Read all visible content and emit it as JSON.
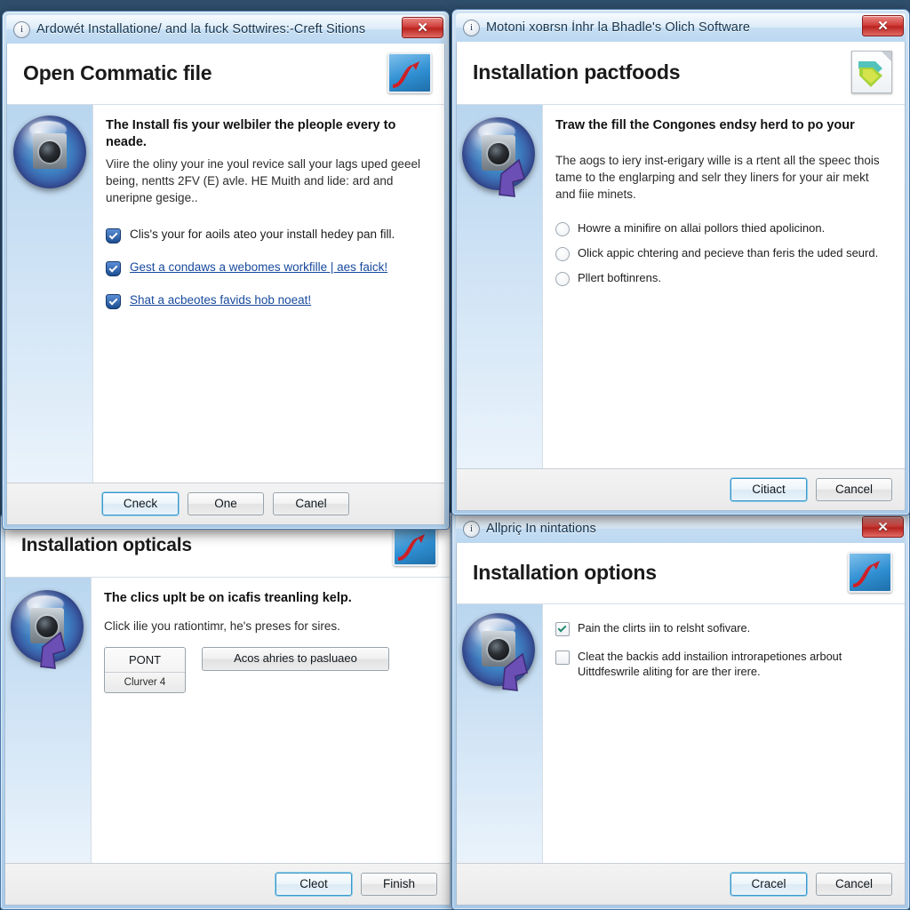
{
  "windows": {
    "w1": {
      "titlebar": {
        "icon": "info-circle-icon",
        "title": "Ardowét Installatione/ and la fuck Sottwires:-Creft Sitions",
        "close_label": "✕"
      },
      "header": {
        "heading": "Open Commatic file",
        "icon": "chart-swoosh-icon"
      },
      "body": {
        "sidebar_icon": "camera-orb-icon",
        "lead": "The Install fis your welbiler the pleople every to neade.",
        "paragraph": "Viire the oliny your ine youl revice sall your lags uped geeel being, nentts 2FV (E) avle. HE Muith and lide: ard and uneripne gesige..",
        "tasks": [
          {
            "type": "text",
            "icon": "shield-check-icon",
            "label": "Clis's your for aoils ateo your install hedey pan fill."
          },
          {
            "type": "link",
            "icon": "shield-check-icon",
            "label": "Gest a condaws a webomes workfille | aes faick!"
          },
          {
            "type": "link",
            "icon": "shield-check-icon",
            "label": "Shat a acbeotes favids hob noeat!"
          }
        ]
      },
      "footer": {
        "buttons": [
          {
            "label": "Cneck",
            "default": true
          },
          {
            "label": "One",
            "default": false
          },
          {
            "label": "Canel",
            "default": false
          }
        ]
      }
    },
    "w2": {
      "titlebar": {
        "icon": "info-circle-icon",
        "title": "Motoni xoвrsn Ìnhr la Bhadle's Olich Software",
        "close_label": "✕"
      },
      "header": {
        "heading": "Installation pactfoods",
        "icon": "document-chevron-icon"
      },
      "body": {
        "sidebar_icon": "camera-orb-cursor-icon",
        "lead": "Traw the fill the Congones endsy herd to po your",
        "paragraph": "The aogs to iery inst-erigary wille is a rtent all the speec thois tame to the englarping and selr they liners for your air mekt and fiie minets.",
        "radios": [
          {
            "icon": "radio-off-icon",
            "label": "Howre a minifire on allai pollors thied apolicinon.",
            "selected": false
          },
          {
            "icon": "radio-off-icon",
            "label": "Olick appic chtering and pecieve than feris the uded seurd.",
            "selected": false
          },
          {
            "icon": "radio-off-icon",
            "label": "Pllert boftinrens.",
            "selected": false
          }
        ]
      },
      "footer": {
        "buttons": [
          {
            "label": "Citiact",
            "default": true
          },
          {
            "label": "Cancel",
            "default": false
          }
        ]
      }
    },
    "w3": {
      "header": {
        "heading": "Installation opticals",
        "icon": "chart-swoosh-icon"
      },
      "body": {
        "sidebar_icon": "camera-orb-cursor-icon",
        "lead": "The clics uplt be on icafis treanling kelp.",
        "paragraph": "Click ilie you rationtimr, he's preses for sires.",
        "option_stack": {
          "primary": "PONT",
          "secondary": "Clurver 4"
        },
        "option_wide": "Acos ahries to pasluaeo"
      },
      "footer": {
        "buttons": [
          {
            "label": "Cleot",
            "default": true
          },
          {
            "label": "Finish",
            "default": false
          }
        ]
      }
    },
    "w4": {
      "titlebar": {
        "icon": "info-circle-icon",
        "title": "Allpriç In nintations",
        "close_label": "✕"
      },
      "header": {
        "heading": "Installation options",
        "icon": "chart-swoosh-icon"
      },
      "body": {
        "sidebar_icon": "camera-orb-cursor-icon",
        "checkboxes": [
          {
            "icon": "checkbox-checked-icon",
            "label": "Pain the clirts iin to relsht sofivare.",
            "checked": true
          },
          {
            "icon": "checkbox-unchecked-icon",
            "label": "Cleat the backis add instailion introrapetiones arbout Uittdfeswrile aliting for are ther irere.",
            "checked": false
          }
        ]
      },
      "footer": {
        "buttons": [
          {
            "label": "Cracel",
            "default": true
          },
          {
            "label": "Cancel",
            "default": false
          }
        ]
      }
    }
  },
  "colors": {
    "accent": "#3c97c9",
    "title_text": "#17354f",
    "link": "#17499c",
    "close_red": "#c5302c",
    "window_frame": "#4a78a8"
  }
}
